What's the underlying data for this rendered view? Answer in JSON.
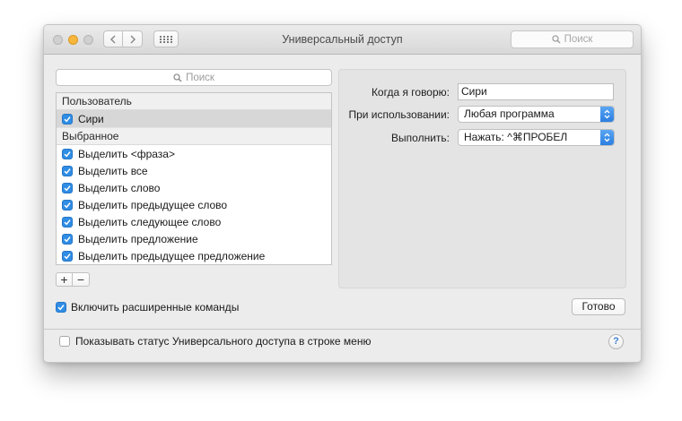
{
  "window": {
    "title": "Универсальный доступ",
    "search_placeholder": "Поиск"
  },
  "sheet": {
    "search_placeholder": "Поиск",
    "sections": [
      {
        "header": "Пользователь",
        "items": [
          {
            "label": "Сири",
            "checked": true,
            "selected": true
          }
        ]
      },
      {
        "header": "Выбранное",
        "items": [
          {
            "label": "Выделить <фраза>",
            "checked": true
          },
          {
            "label": "Выделить все",
            "checked": true
          },
          {
            "label": "Выделить слово",
            "checked": true
          },
          {
            "label": "Выделить предыдущее слово",
            "checked": true
          },
          {
            "label": "Выделить следующее слово",
            "checked": true
          },
          {
            "label": "Выделить предложение",
            "checked": true
          },
          {
            "label": "Выделить предыдущее предложение",
            "checked": true
          }
        ]
      }
    ],
    "add_label": "+",
    "remove_label": "−",
    "form": {
      "when_label": "Когда я говорю:",
      "when_value": "Сири",
      "while_label": "При использовании:",
      "while_value": "Любая программа",
      "perform_label": "Выполнить:",
      "perform_value": "Нажать: ^⌘ПРОБЕЛ"
    },
    "enable_advanced_label": "Включить расширенные команды",
    "enable_advanced_checked": true,
    "done_label": "Готово"
  },
  "footer": {
    "show_status_label": "Показывать статус Универсального доступа в строке меню",
    "show_status_checked": false,
    "help_label": "?"
  },
  "colors": {
    "accent": "#2f8de4",
    "window_bg": "#ececec",
    "minimize": "#f6b73c"
  }
}
